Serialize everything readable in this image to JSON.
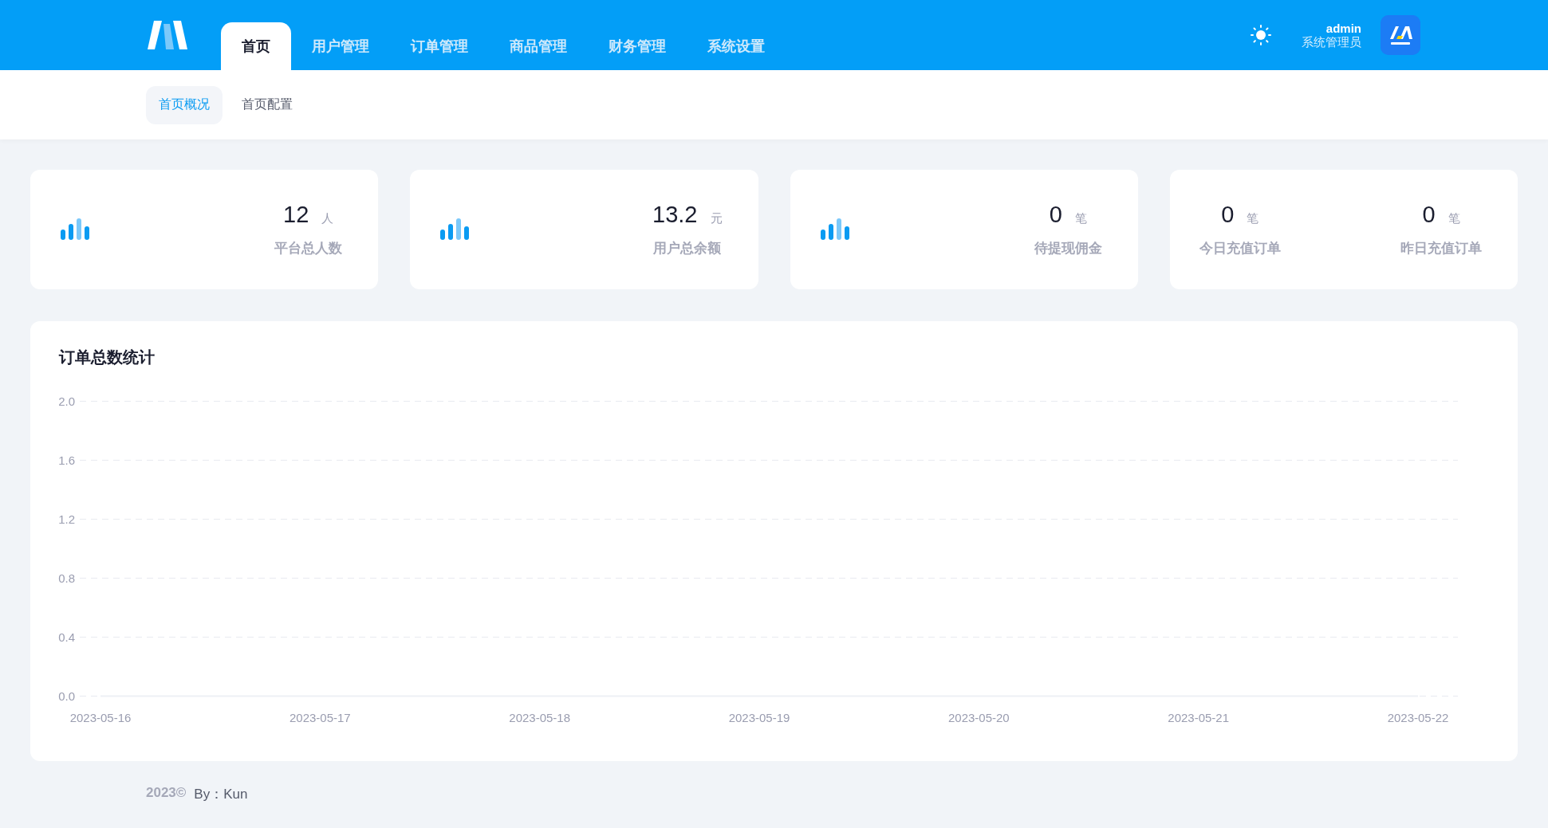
{
  "header": {
    "nav": [
      {
        "label": "首页",
        "selected": true
      },
      {
        "label": "用户管理",
        "selected": false
      },
      {
        "label": "订单管理",
        "selected": false
      },
      {
        "label": "商品管理",
        "selected": false
      },
      {
        "label": "财务管理",
        "selected": false
      },
      {
        "label": "系统设置",
        "selected": false
      }
    ],
    "user": {
      "name": "admin",
      "role": "系统管理员"
    }
  },
  "subnav": [
    {
      "label": "首页概况",
      "selected": true
    },
    {
      "label": "首页配置",
      "selected": false
    }
  ],
  "cards": [
    {
      "kind": "single",
      "items": [
        {
          "value": "12",
          "unit": "人",
          "label": "平台总人数"
        }
      ]
    },
    {
      "kind": "single",
      "items": [
        {
          "value": "13.2",
          "unit": "元",
          "label": "用户总余额"
        }
      ]
    },
    {
      "kind": "single",
      "items": [
        {
          "value": "0",
          "unit": "笔",
          "label": "待提现佣金"
        }
      ]
    },
    {
      "kind": "double",
      "items": [
        {
          "value": "0",
          "unit": "笔",
          "label": "今日充值订单"
        },
        {
          "value": "0",
          "unit": "笔",
          "label": "昨日充值订单"
        }
      ]
    }
  ],
  "chart": {
    "title": "订单总数统计",
    "chart_data": {
      "type": "line",
      "categories": [
        "2023-05-16",
        "2023-05-17",
        "2023-05-18",
        "2023-05-19",
        "2023-05-20",
        "2023-05-21",
        "2023-05-22"
      ],
      "ylim": [
        0,
        2
      ],
      "yticks": [
        {
          "value": 0,
          "label": "0.0"
        },
        {
          "value": 0.4,
          "label": "0.4"
        },
        {
          "value": 0.8,
          "label": "0.8"
        },
        {
          "value": 1.2,
          "label": "1.2"
        },
        {
          "value": 1.6,
          "label": "1.6"
        },
        {
          "value": 2,
          "label": "2.0"
        }
      ],
      "series": [
        {
          "color": "#eef0f5",
          "values": [
            0,
            0,
            0,
            0,
            0,
            0,
            0
          ]
        }
      ]
    }
  },
  "footer": {
    "copyright": "2023©",
    "author": "By：Kun"
  }
}
